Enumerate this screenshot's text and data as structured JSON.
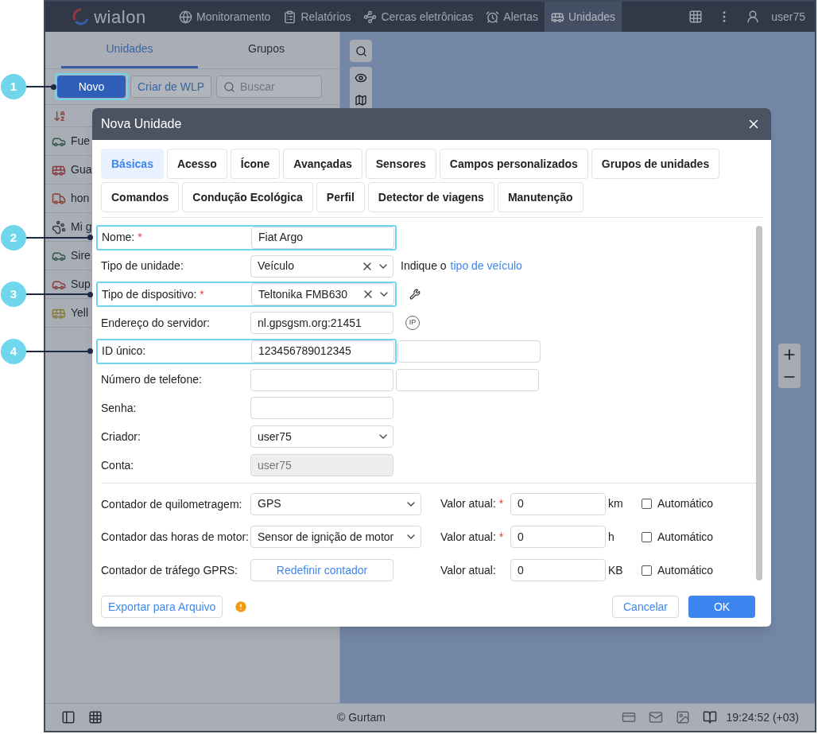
{
  "topbar": {
    "logo": "wialon",
    "nav": [
      {
        "label": "Monitoramento",
        "selected": false
      },
      {
        "label": "Relatórios",
        "selected": false
      },
      {
        "label": "Cercas eletrônicas",
        "selected": false
      },
      {
        "label": "Alertas",
        "selected": false
      },
      {
        "label": "Unidades",
        "selected": true
      }
    ],
    "user": "user75"
  },
  "left_panel": {
    "tabs": [
      {
        "label": "Unidades",
        "selected": true
      },
      {
        "label": "Grupos",
        "selected": false
      }
    ],
    "new_button": {
      "label": "Novo",
      "callout": "1"
    },
    "wlp_button": "Criar de WLP",
    "search": {
      "placeholder": "Buscar"
    },
    "units": [
      {
        "name": "Fue"
      },
      {
        "name": "Gua"
      },
      {
        "name": "hon"
      },
      {
        "name": "Mi g"
      },
      {
        "name": "Sire"
      },
      {
        "name": "Sup"
      },
      {
        "name": "Yell"
      }
    ]
  },
  "dialog": {
    "title": "Nova Unidade",
    "tab_rows": [
      [
        {
          "label": "Básicas",
          "selected": true
        },
        {
          "label": "Acesso",
          "selected": false
        },
        {
          "label": "Ícone",
          "selected": false
        },
        {
          "label": "Avançadas",
          "selected": false
        },
        {
          "label": "Sensores",
          "selected": false
        },
        {
          "label": "Campos personalizados",
          "selected": false
        },
        {
          "label": "Grupos de unidades",
          "selected": false
        }
      ],
      [
        {
          "label": "Comandos",
          "selected": false
        },
        {
          "label": "Condução Ecológica",
          "selected": false
        },
        {
          "label": "Perfil",
          "selected": false
        },
        {
          "label": "Detector de viagens",
          "selected": false
        },
        {
          "label": "Manutenção",
          "selected": false
        }
      ]
    ],
    "fields": [
      {
        "label": "Nome:",
        "required_mark": "*",
        "kind": "input",
        "value": "Fiat Argo",
        "callout": "2"
      },
      {
        "label": "Tipo de unidade:",
        "kind": "select",
        "value": "Veículo",
        "clearable": true,
        "hint": "Indique o",
        "link": "tipo de veículo"
      },
      {
        "label": "Tipo de dispositivo:",
        "required_mark": "*",
        "kind": "select",
        "value": "Teltonika FMB630",
        "clearable": true,
        "tool": true,
        "callout": "3"
      },
      {
        "label": "Endereço do servidor:",
        "kind": "input",
        "value": "nl.gpsgsm.org:21451",
        "badge": "IP"
      },
      {
        "label": "ID único:",
        "kind": "input",
        "value": "123456789012345",
        "paired": true,
        "callout": "4"
      },
      {
        "label": "Número de telefone:",
        "kind": "input",
        "paired": true
      },
      {
        "label": "Senha:",
        "kind": "input"
      },
      {
        "label": "Criador:",
        "kind": "select",
        "value": "user75"
      },
      {
        "label": "Conta:",
        "kind": "disabled",
        "value": "user75"
      }
    ],
    "counters": [
      {
        "label": "Contador de quilometragem:",
        "kind": "select",
        "value": "GPS",
        "reading_label": "Valor atual:",
        "required_mark": "*",
        "reading": "0",
        "unit": "km",
        "auto_label": "Automático",
        "auto_checked": false
      },
      {
        "label": "Contador das horas de motor:",
        "kind": "select",
        "value": "Sensor de ignição de motor",
        "reading_label": "Valor atual:",
        "required_mark": "*",
        "reading": "0",
        "unit": "h",
        "auto_label": "Automático",
        "auto_checked": false
      },
      {
        "label": "Contador de tráfego GPRS:",
        "kind": "button",
        "value": "Redefinir contador",
        "reading_label": "Valor atual:",
        "reading": "0",
        "unit": "KB",
        "auto_label": "Automático",
        "auto_checked": false
      }
    ],
    "export_button": "Exportar para Arquivo",
    "cancel_button": "Cancelar",
    "ok_button": "OK"
  },
  "status_bar": {
    "copyright": "© Gurtam",
    "time": "19:24:52 (+03)"
  }
}
